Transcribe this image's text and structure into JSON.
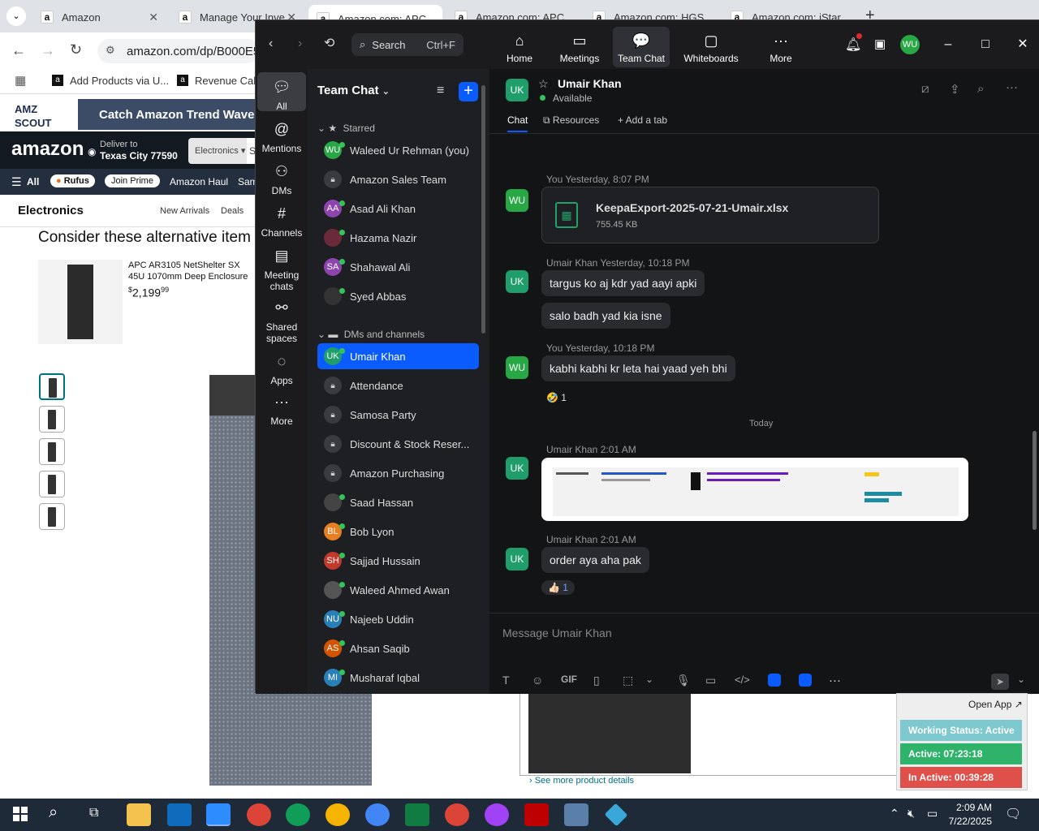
{
  "browser": {
    "tabs": [
      {
        "title": "Amazon",
        "active": false
      },
      {
        "title": "Manage Your Inve",
        "active": false
      },
      {
        "title": "Amazon.com: APC",
        "active": true
      },
      {
        "title": "Amazon.com: APC",
        "active": false
      },
      {
        "title": "Amazon.com: HGS",
        "active": false
      },
      {
        "title": "Amazon.com: iStar",
        "active": false
      }
    ],
    "address": "amazon.com/dp/B000E52",
    "bookmarks": [
      "Add Products via U...",
      "Revenue Calcu"
    ]
  },
  "amazon": {
    "scout_logo": "AMZ SCOUT",
    "scout_banner": "Catch Amazon Trend Wave",
    "logo": "amazon",
    "deliver_line1": "Deliver to",
    "deliver_line2": "Texas City 77590",
    "search_dept": "Electronics",
    "search_dept2": "S",
    "nav": [
      "All",
      "Rufus",
      "Join Prime",
      "Amazon Haul",
      "Sam"
    ],
    "category": "Electronics",
    "subnav": [
      "New Arrivals",
      "Deals"
    ],
    "alt_heading": "Consider these alternative item",
    "alt_product_title": "APC AR3105 NetShelter SX 45U 1070mm Deep Enclosure with",
    "alt_product_price_symbol": "$",
    "alt_product_price_whole": "2,199",
    "alt_product_price_cents": "99",
    "see_more": "› See more product details"
  },
  "zoom": {
    "search_label": "Search",
    "search_shortcut": "Ctrl+F",
    "nav": [
      {
        "label": "Home",
        "icon": "home-icon"
      },
      {
        "label": "Meetings",
        "icon": "video-icon"
      },
      {
        "label": "Team Chat",
        "icon": "chat-icon"
      },
      {
        "label": "Whiteboards",
        "icon": "whiteboard-icon"
      },
      {
        "label": "More",
        "icon": "more-icon"
      }
    ],
    "user_initials": "WU",
    "rail": [
      "All",
      "Mentions",
      "DMs",
      "Channels",
      "Meeting chats",
      "Shared spaces",
      "Apps",
      "More"
    ],
    "list_title": "Team Chat",
    "sections": {
      "starred": "Starred",
      "dms": "DMs and channels"
    },
    "starred": [
      {
        "name": "Waleed Ur Rehman (you)",
        "initials": "WU",
        "color": "#28a745",
        "type": "avatar"
      },
      {
        "name": "Amazon Sales Team",
        "type": "lock"
      },
      {
        "name": "Asad Ali Khan",
        "initials": "AA",
        "color": "#8e44ad",
        "type": "avatar"
      },
      {
        "name": "Hazama Nazir",
        "initials": "",
        "color": "#6b2a3a",
        "type": "photo"
      },
      {
        "name": "Shahawal Ali",
        "initials": "SA",
        "color": "#8e44ad",
        "type": "avatar"
      },
      {
        "name": "Syed Abbas",
        "initials": "",
        "color": "#333333",
        "type": "photo"
      }
    ],
    "dms": [
      {
        "name": "Umair Khan",
        "initials": "UK",
        "color": "#1f9d6a",
        "type": "avatar",
        "selected": true
      },
      {
        "name": "Attendance",
        "type": "lock"
      },
      {
        "name": "Samosa Party",
        "type": "lock"
      },
      {
        "name": "Discount & Stock Reser...",
        "type": "lock"
      },
      {
        "name": "Amazon Purchasing",
        "type": "lock"
      },
      {
        "name": "Saad Hassan",
        "initials": "",
        "color": "#444444",
        "type": "photo"
      },
      {
        "name": "Bob Lyon",
        "initials": "BL",
        "color": "#e67e22",
        "type": "avatar"
      },
      {
        "name": "Sajjad Hussain",
        "initials": "SH",
        "color": "#c0392b",
        "type": "avatar"
      },
      {
        "name": "Waleed Ahmed Awan",
        "initials": "",
        "color": "#555555",
        "type": "photo"
      },
      {
        "name": "Najeeb Uddin",
        "initials": "NU",
        "color": "#2980b9",
        "type": "avatar"
      },
      {
        "name": "Ahsan Saqib",
        "initials": "AS",
        "color": "#d35400",
        "type": "avatar"
      },
      {
        "name": "Musharaf Iqbal",
        "initials": "MI",
        "color": "#2980b9",
        "type": "avatar"
      }
    ],
    "chat": {
      "contact_name": "Umair Khan",
      "contact_initials": "UK",
      "status": "Available",
      "tabs": [
        "Chat",
        "Resources",
        "+ Add a tab"
      ],
      "file_meta": "You Yesterday, 8:07 PM",
      "file_name": "KeepaExport-2025-07-21-Umair.xlsx",
      "file_size": "755.45 KB",
      "messages": [
        {
          "meta": "Umair Khan Yesterday, 10:18 PM",
          "texts": [
            "targus ko aj kdr yad aayi apki",
            "salo badh yad kia isne"
          ]
        },
        {
          "meta": "You Yesterday, 10:18 PM",
          "texts": [
            "kabhi kabhi kr leta hai yaad yeh bhi"
          ],
          "reaction": "🤣",
          "reaction_count": "1"
        },
        {
          "meta": "Umair Khan 2:01 AM"
        },
        {
          "meta": "Umair Khan 2:01 AM",
          "texts": [
            "order aya aha pak"
          ],
          "reaction": "👍🏻",
          "reaction_count": "1"
        }
      ],
      "divider": "Today",
      "composer_placeholder": "Message Umair Khan"
    }
  },
  "widget": {
    "open_app": "Open App ↗",
    "working": "Working Status: Active",
    "active": "Active: 07:23:18",
    "inactive": "In Active: 00:39:28"
  },
  "taskbar": {
    "time": "2:09 AM",
    "date": "7/22/2025"
  },
  "colors": {
    "zoom_blue": "#0b5cff",
    "online_green": "#33c45a",
    "amazon_dark": "#131921"
  }
}
